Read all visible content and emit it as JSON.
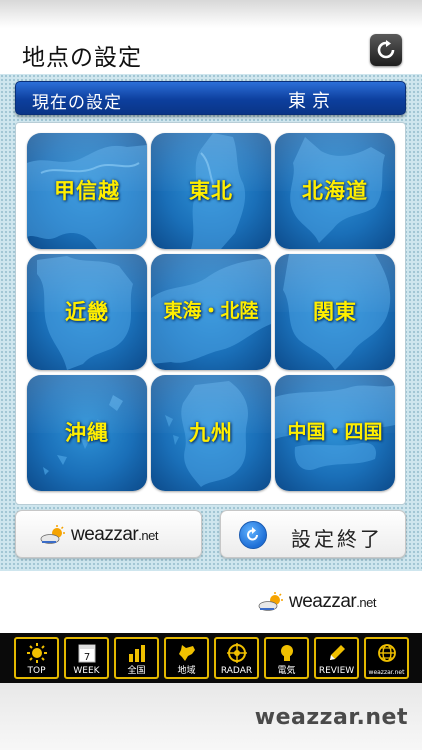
{
  "header": {
    "title": "地点の設定",
    "refresh_icon": "refresh-icon"
  },
  "current": {
    "label": "現在の設定",
    "value": "東京"
  },
  "regions": [
    {
      "label": "甲信越"
    },
    {
      "label": "東北"
    },
    {
      "label": "北海道"
    },
    {
      "label": "近畿"
    },
    {
      "label": "東海・北陸"
    },
    {
      "label": "関東"
    },
    {
      "label": "沖縄"
    },
    {
      "label": "九州"
    },
    {
      "label": "中国・四国"
    }
  ],
  "buttons": {
    "logo_word": "weazzar",
    "logo_net": ".net",
    "done_label": "設定終了"
  },
  "ad": {
    "logo_word": "weazzar",
    "logo_net": ".net"
  },
  "nav": [
    {
      "label": "TOP",
      "icon": "sun-icon"
    },
    {
      "label": "WEEK",
      "icon": "calendar-icon",
      "badge": "7"
    },
    {
      "label": "全国",
      "icon": "bar-chart-icon"
    },
    {
      "label": "地域",
      "icon": "hokkaido-map-icon"
    },
    {
      "label": "RADAR",
      "icon": "radar-icon"
    },
    {
      "label": "電気",
      "icon": "lightbulb-icon"
    },
    {
      "label": "REVIEW",
      "icon": "pencil-icon"
    },
    {
      "label": "weazzar.net",
      "icon": "globe-icon"
    }
  ],
  "footer": {
    "brand": "weazzar.net"
  },
  "colors": {
    "accent_yellow": "#ffee00",
    "bar_blue": "#0d3f9e",
    "nav_gold": "#e3b800"
  }
}
